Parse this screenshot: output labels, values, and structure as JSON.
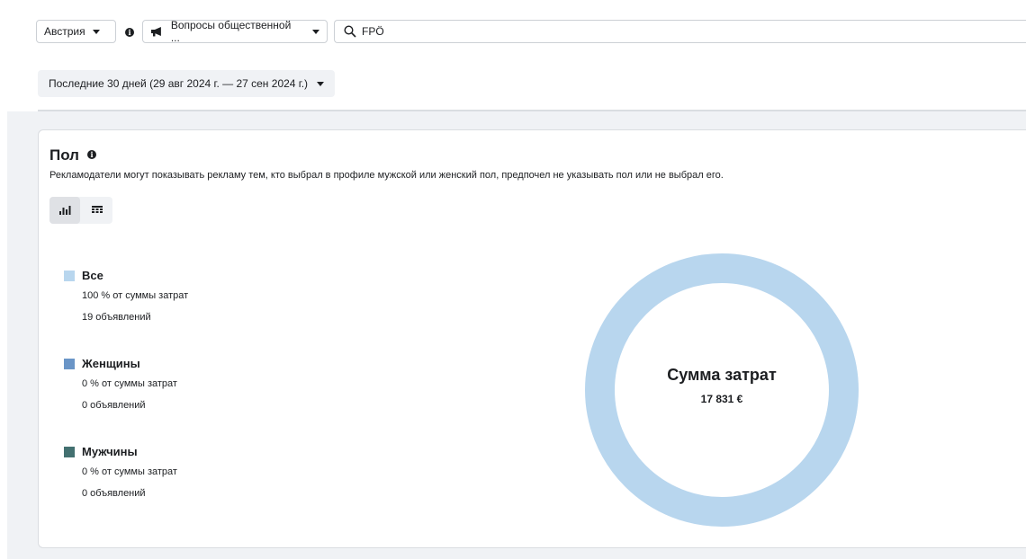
{
  "filters": {
    "country": "Австрия",
    "category": "Вопросы общественной ...",
    "search_value": "FPÖ"
  },
  "date_range": "Последние 30 дней (29 авг 2024 г. — 27 сен 2024 г.)",
  "card": {
    "title": "Пол",
    "description": "Рекламодатели могут показывать рекламу тем, кто выбрал в профиле мужской или женский пол, предпочел не указывать пол или не выбрал его.",
    "view_toggles": [
      "bar-chart-icon",
      "table-icon"
    ]
  },
  "legend": [
    {
      "name": "Все",
      "share": "100 % от суммы затрат",
      "ads": "19 объявлений",
      "color": "#b8d6ee"
    },
    {
      "name": "Женщины",
      "share": "0 % от суммы затрат",
      "ads": "0 объявлений",
      "color": "#6a95c7"
    },
    {
      "name": "Мужчины",
      "share": "0 % от суммы затрат",
      "ads": "0 объявлений",
      "color": "#437070"
    }
  ],
  "donut": {
    "center_title": "Сумма затрат",
    "center_value": "17 831 €"
  },
  "chart_data": {
    "type": "pie",
    "categories": [
      "Все",
      "Женщины",
      "Мужчины"
    ],
    "values": [
      100,
      0,
      0
    ],
    "colors": [
      "#b8d6ee",
      "#6a95c7",
      "#437070"
    ]
  }
}
